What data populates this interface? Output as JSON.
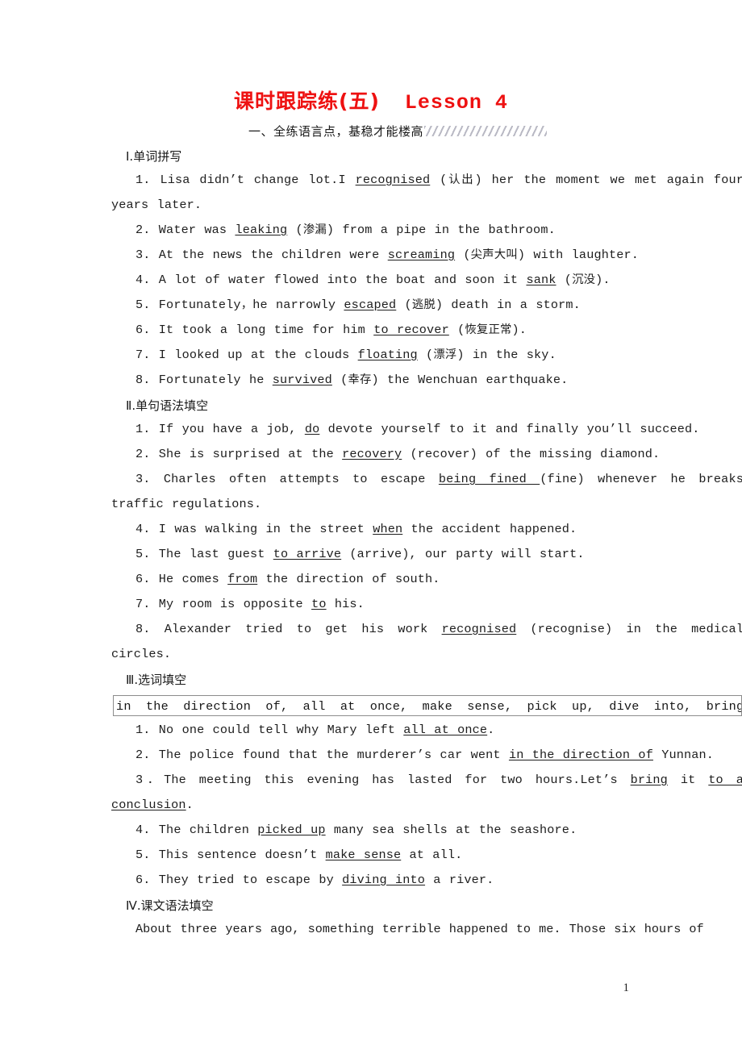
{
  "document": {
    "title_cn": "课时跟踪练(五)",
    "title_en": "Lesson 4",
    "title_color": "#ee1111",
    "page_number": "1"
  },
  "part_one": {
    "banner_label": "一、全练语言点，基稳才能楼高"
  },
  "sections": {
    "s1_heading": "Ⅰ.单词拼写",
    "s2_heading": "Ⅱ.单句语法填空",
    "s3_heading": "Ⅲ.选词填空",
    "s4_heading": "Ⅳ.课文语法填空"
  },
  "spelling_items": [
    "1. Lisa didn’t change lot.I <u>recognised</u> (认出) her the moment we met again four years later.",
    "2. Water was <u>leaking</u> (渗漏) from a pipe in the bathroom.",
    "3. At the news the children were <u>screaming</u> (尖声大叫) with laughter.",
    "4. A lot of water flowed into the boat and soon it <u>sank</u> (沉没).",
    "5. Fortunately，he narrowly <u>escaped</u> (逃脱) death in a storm.",
    "6. It took a long time for him <u>to recover</u> (恢复正常).",
    "7. I looked up at the clouds <u>floating</u> (漂浮) in the sky.",
    "8. Fortunately he <u>survived</u> (幸存) the Wenchuan earthquake."
  ],
  "grammar_items": [
    "1. If you have a job, <u>do</u> devote yourself to it and finally you’ll succeed.",
    "2. She is surprised at the <u>recovery</u> (recover) of the missing diamond.",
    "3. Charles often attempts to escape <u>being fined </u> (fine) whenever he breaks traffic regulations.",
    "4. I was walking in the street <u>when</u> the accident happened.",
    "5. The last guest <u>to arrive</u> (arrive), our party will start.",
    "6. He comes <u>from</u> the direction of south.",
    "7. My room is opposite <u>to</u> his.",
    "8. Alexander tried to get his work <u>recognised</u> (recognise) in the medical circles."
  ],
  "word_bank": "in the direction of,  all at once,  make sense,  pick up,  dive into,  bring ..",
  "wordfill_items": [
    "1. No one could tell why Mary left <u>all at once</u>.",
    "2. The police found that the murderer’s car went <u>in the direction of</u> Yunnan.",
    "3．The meeting this evening has lasted for two hours.Let’s <u>bring</u> it <u>to a conclusion</u>.",
    "4. The children <u>picked up</u> many sea shells at the seashore.",
    "5. This sentence doesn’t <u>make sense</u> at all.",
    "6. They tried to escape by <u>diving into</u> a river."
  ],
  "passage": {
    "text": "About three years ago, something terrible happened to me. Those six hours of"
  }
}
